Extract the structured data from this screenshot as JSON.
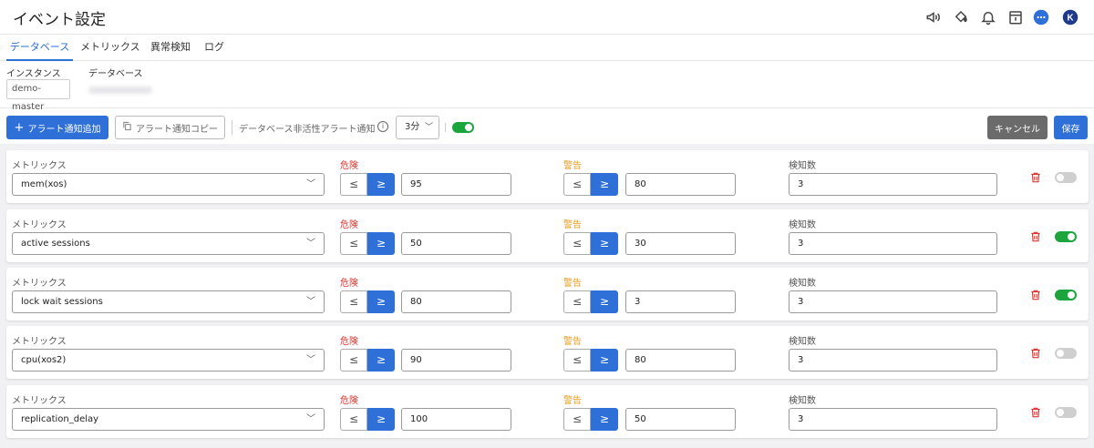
{
  "header": {
    "title": "イベント設定",
    "avatar_letter": "K",
    "icons": [
      "megaphone-icon",
      "paint-bucket-icon",
      "bell-icon",
      "calendar-icon",
      "chat-icon"
    ]
  },
  "tabs": [
    {
      "label": "データベース",
      "active": true
    },
    {
      "label": "メトリックス",
      "active": false
    },
    {
      "label": "異常検知",
      "active": false
    },
    {
      "label": "ログ",
      "active": false
    }
  ],
  "filters": {
    "instance_label": "インスタンス",
    "instance_value": "demo-master",
    "database_label": "データベース"
  },
  "toolbar": {
    "add_label": "アラート通知追加",
    "copy_label": "アラート通知コピー",
    "inactive_label": "データベース非活性アラート通知",
    "info": "i",
    "interval_value": "3分",
    "inactive_toggle_on": true,
    "cancel_label": "キャンセル",
    "save_label": "保存"
  },
  "columns": {
    "metric": "メトリックス",
    "danger": "危険",
    "warning": "警告",
    "count": "検知数"
  },
  "operators": {
    "le": "≤",
    "ge": "≥"
  },
  "colors": {
    "accent": "#2f6fd8",
    "danger": "#d8352f",
    "warning": "#e59a1b",
    "toggle_on": "#1ca53d",
    "toggle_off": "#cfcfcf"
  },
  "rules": [
    {
      "metric": "mem(xos)",
      "danger_op": "≥",
      "danger": "95",
      "warning_op": "≥",
      "warning": "80",
      "count": "3",
      "enabled": false
    },
    {
      "metric": "active sessions",
      "danger_op": "≥",
      "danger": "50",
      "warning_op": "≥",
      "warning": "30",
      "count": "3",
      "enabled": true
    },
    {
      "metric": "lock wait sessions",
      "danger_op": "≥",
      "danger": "80",
      "warning_op": "≥",
      "warning": "3",
      "count": "3",
      "enabled": true
    },
    {
      "metric": "cpu(xos2)",
      "danger_op": "≥",
      "danger": "90",
      "warning_op": "≥",
      "warning": "80",
      "count": "3",
      "enabled": false
    },
    {
      "metric": "replication_delay",
      "danger_op": "≥",
      "danger": "100",
      "warning_op": "≥",
      "warning": "50",
      "count": "3",
      "enabled": false
    }
  ]
}
